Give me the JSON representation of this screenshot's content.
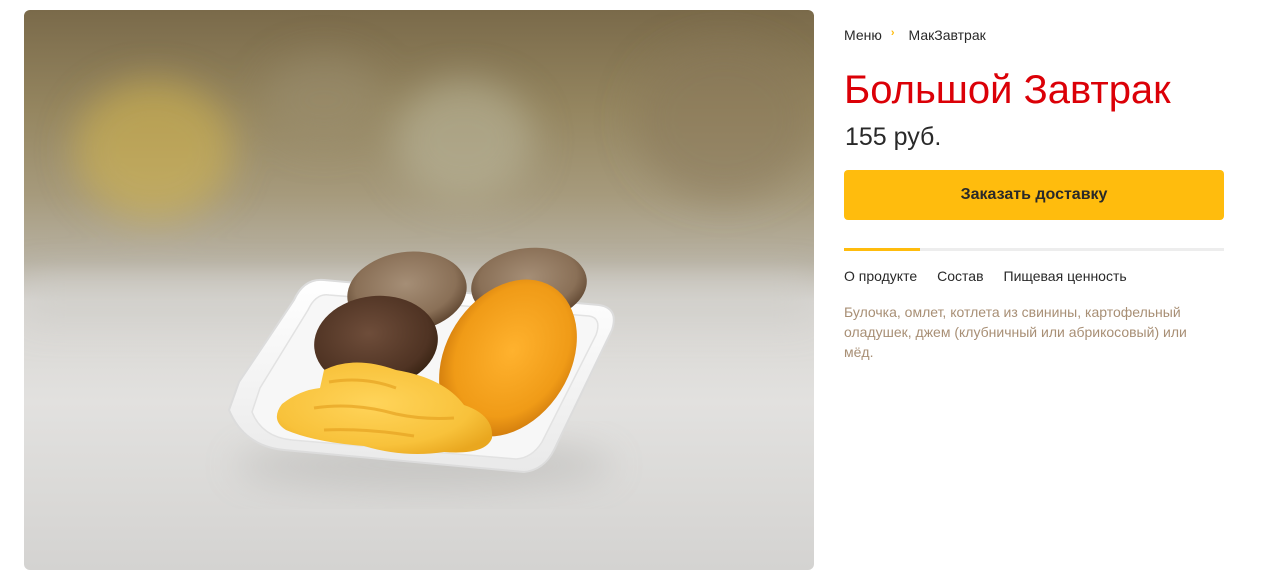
{
  "product_image": {
    "alt": "Большой Завтрак"
  },
  "breadcrumb": {
    "items": [
      "Меню",
      "МакЗавтрак"
    ],
    "separator": "›"
  },
  "product": {
    "title": "Большой Завтрак",
    "price": "155 руб."
  },
  "order_button": {
    "label": "Заказать доставку"
  },
  "tabs": {
    "items": [
      "О продукте",
      "Состав",
      "Пищевая ценность"
    ],
    "active_index": 0
  },
  "description": "Булочка, омлет, котлета из свинины, картофельный оладушек, джем (клубничный или абрикосовый) или мёд.",
  "colors": {
    "title_red": "#db0007",
    "accent_yellow": "#ffbc0d",
    "text_dark": "#292929",
    "description_brown": "#a88f75"
  }
}
